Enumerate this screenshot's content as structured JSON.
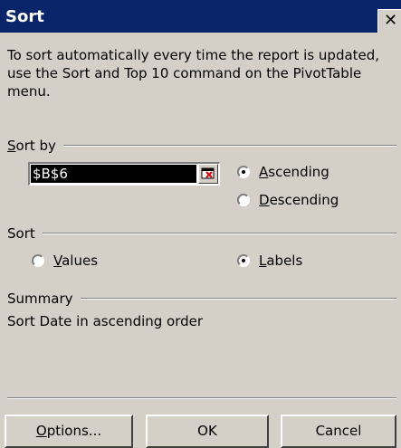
{
  "window": {
    "title": "Sort"
  },
  "description": "To sort automatically every time the report is updated, use the Sort and Top 10 command on the PivotTable menu.",
  "sort_by": {
    "label_prefix": "S",
    "label_rest": "ort by",
    "range_value": "$B$6",
    "ascending": {
      "accel": "A",
      "rest": "scending",
      "selected": true
    },
    "descending": {
      "accel": "D",
      "rest": "escending",
      "selected": false
    }
  },
  "sort": {
    "label": "Sort",
    "values": {
      "accel": "V",
      "rest": "alues",
      "selected": false
    },
    "labels": {
      "accel": "L",
      "rest": "abels",
      "selected": true
    }
  },
  "summary": {
    "label": "Summary",
    "text": "Sort Date in ascending order"
  },
  "buttons": {
    "options": {
      "accel": "O",
      "rest": "ptions..."
    },
    "ok": "OK",
    "cancel": "Cancel"
  }
}
